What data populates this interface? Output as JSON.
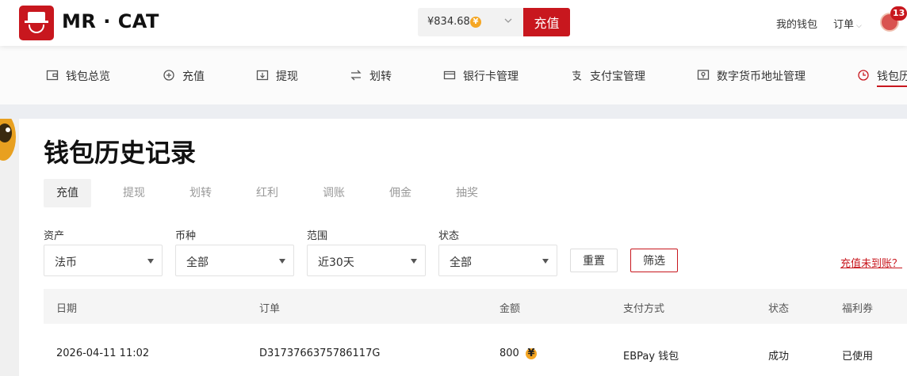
{
  "header": {
    "brand": "MR · CAT",
    "balance": "¥834.68",
    "coin_symbol": "¥",
    "recharge_label": "充值",
    "my_wallet": "我的钱包",
    "orders": "订单",
    "notification_count": "13",
    "accent_color": "#c8171e"
  },
  "nav": {
    "items": [
      {
        "label": "钱包总览",
        "icon": "wallet-icon"
      },
      {
        "label": "充值",
        "icon": "recharge-icon"
      },
      {
        "label": "提现",
        "icon": "withdraw-icon"
      },
      {
        "label": "划转",
        "icon": "transfer-icon"
      },
      {
        "label": "银行卡管理",
        "icon": "bank-card-icon"
      },
      {
        "label": "支付宝管理",
        "icon": "alipay-icon"
      },
      {
        "label": "数字货币地址管理",
        "icon": "crypto-address-icon"
      },
      {
        "label": "钱包历",
        "icon": "clock-icon",
        "active": true
      }
    ]
  },
  "page": {
    "title": "钱包历史记录",
    "tabs": [
      {
        "label": "充值",
        "active": true
      },
      {
        "label": "提现"
      },
      {
        "label": "划转"
      },
      {
        "label": "红利"
      },
      {
        "label": "调账"
      },
      {
        "label": "佣金"
      },
      {
        "label": "抽奖"
      }
    ]
  },
  "filters": {
    "asset": {
      "label": "资产",
      "value": "法币"
    },
    "currency": {
      "label": "币种",
      "value": "全部"
    },
    "range": {
      "label": "范围",
      "value": "近30天"
    },
    "status": {
      "label": "状态",
      "value": "全部"
    },
    "reset_label": "重置",
    "filter_label": "筛选",
    "missing_link": "充值未到账？"
  },
  "table": {
    "headers": [
      "日期",
      "订单",
      "金额",
      "支付方式",
      "状态",
      "福利券"
    ],
    "rows": [
      {
        "date": "2026-04-11 11:02",
        "order": "D3173766375786117G",
        "amount": "800",
        "method": "EBPay 钱包",
        "status": "成功",
        "coupon": "已使用"
      }
    ]
  }
}
